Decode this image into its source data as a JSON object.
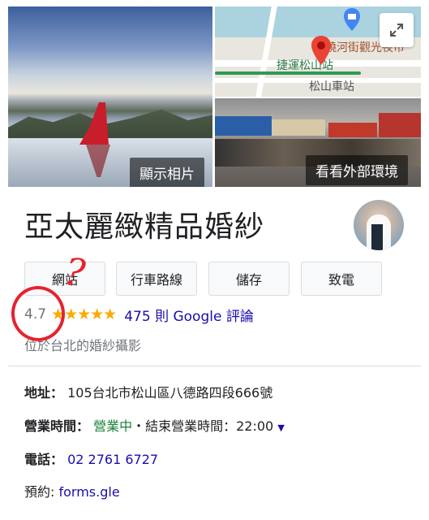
{
  "photos": {
    "show_photos_label": "顯示相片",
    "street_view_label": "看看外部環境",
    "map_labels": [
      "饒河街觀光夜市",
      "捷運松山站",
      "松山車站"
    ]
  },
  "business": {
    "name": "亞太麗緻精品婚紗",
    "rating": "4.7",
    "stars": "★★★★★",
    "review_count_text": "475 則 Google 評論",
    "category": "位於台北的婚紗攝影"
  },
  "actions": {
    "website": "網站",
    "directions": "行車路線",
    "save": "儲存",
    "call": "致電"
  },
  "info": {
    "address_label": "地址：",
    "address_value": "105台北市松山區八德路四段666號",
    "hours_label": "營業時間：",
    "hours_status": "營業中",
    "hours_sep": "・結束營業時間：22:00",
    "phone_label": "電話：",
    "phone_value": "02 2761 6727",
    "booking_label": "預約: ",
    "booking_value": "forms.gle"
  },
  "annotation": {
    "question_mark": "?"
  }
}
